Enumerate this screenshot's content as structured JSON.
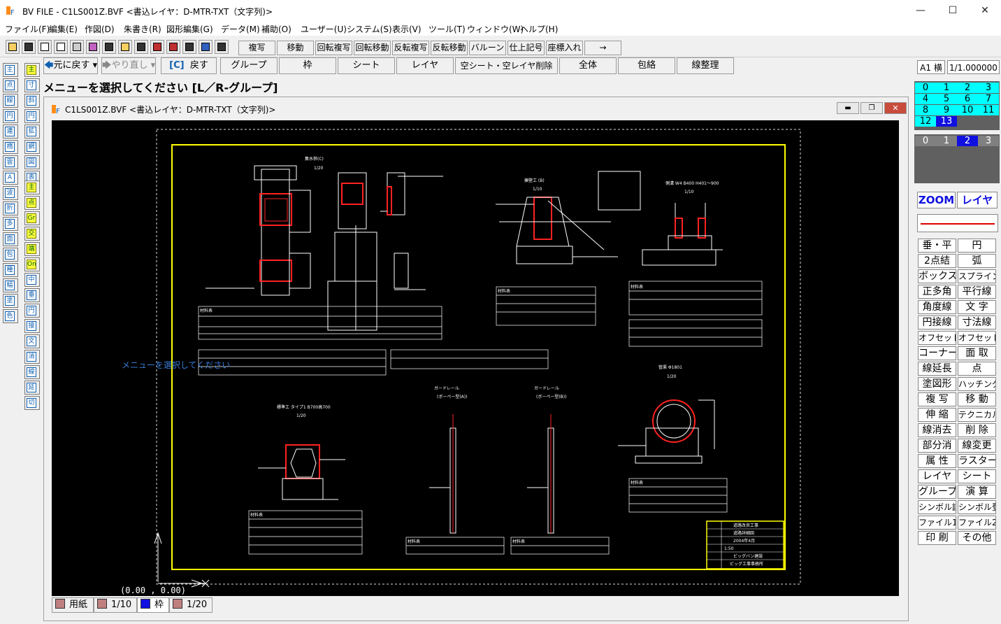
{
  "window": {
    "title": "BV FILE - C1LS001Z.BVF <書込レイヤ：D-MTR-TXT（文字列)>",
    "minimize": "—",
    "maximize": "☐",
    "close": "✕"
  },
  "menu": [
    "ファイル(F)",
    "編集(E)",
    "作図(D)",
    "朱書き(R)",
    "図形編集(G)",
    "データ(M)",
    "補助(O)",
    "ユーザー(U)",
    "システム(S)",
    "表示(V)",
    "ツール(T)",
    "ウィンドウ(W)",
    "ヘルプ(H)"
  ],
  "toolbar1": [
    "複写",
    "移動",
    "回転複写",
    "回転移動",
    "反転複写",
    "反転移動",
    "バルーン",
    "仕上記号",
    "座標入れ",
    "→"
  ],
  "toolbar2": {
    "undo": "元に戻す",
    "redo": "やり直し",
    "back_key": "[C]",
    "back": "戻す",
    "buttons": [
      "グループ",
      "枠",
      "シート",
      "レイヤ",
      "空シート・空レイヤ削除",
      "全体",
      "包絡",
      "線整理"
    ]
  },
  "paper": "A1 横",
  "scale": "1/1.000000",
  "prompt": "メニューを選択してください [L／R-グループ]",
  "doc": {
    "title": "C1LS001Z.BVF <書込レイヤ：D-MTR-TXT（文字列)>",
    "overlay_text": "メニューを選択してください",
    "coord": "(0.00 , 0.00)",
    "drawing_labels": [
      "集水桝(C)",
      "1/20",
      "擁壁工 (B)",
      "1/10",
      "側溝 W4 B400 H401～900",
      "1/10",
      "標準工 タイプ1 B700高700",
      "1/20",
      "ガードレール",
      "(ボーペー型(A))",
      "ガードレール",
      "(ボーペー型(B))",
      "管渠 Φ1801",
      "1/20",
      "材料表",
      "材料表",
      "材料表",
      "材料表",
      "材料表",
      "材料表",
      "材料表"
    ],
    "title_block": [
      "道路改良工事",
      "道路詳細図",
      "2004年4月",
      "1:50",
      "ビッグバン建設",
      "ビッグ工事事務所"
    ],
    "tabs": [
      "用紙",
      "1/10",
      "枠",
      "1/20"
    ]
  },
  "layer_groups": [
    "0",
    "1",
    "2",
    "3",
    "4",
    "5",
    "6",
    "7",
    "8",
    "9",
    "10",
    "11",
    "12",
    "13"
  ],
  "layers": [
    "0",
    "1",
    "2",
    "3"
  ],
  "zoom": "ZOOM",
  "layer_btn": "レイヤ",
  "commands": [
    "垂・平",
    "円",
    "2点結",
    "弧",
    "ボックス",
    "スプライン",
    "正多角",
    "平行線",
    "角度線",
    "文 字",
    "円接線",
    "寸法線",
    "オフセット1",
    "オフセット2",
    "コーナー",
    "面 取",
    "線延長",
    "点",
    "塗図形",
    "ハッチング",
    "複 写",
    "移 動",
    "伸 縮",
    "テクニカル",
    "線消去",
    "削 除",
    "部分消",
    "線変更",
    "属 性",
    "ラスター",
    "レイヤ",
    "シート",
    "グループ",
    "演 算",
    "シンボル読",
    "シンボル登",
    "ファイル1",
    "ファイル2",
    "印 刷",
    "その他"
  ],
  "palette_a": [
    "主",
    "点",
    "線",
    "円",
    "連",
    "楕",
    "雲",
    "A",
    "波",
    "折",
    "多",
    "面",
    "包",
    "種",
    "幅",
    "塗",
    "色"
  ],
  "palette_b": [
    "主",
    "寸",
    "斜",
    "円",
    "拡",
    "網",
    "図",
    "表"
  ],
  "palette_c": [
    "主",
    "点",
    "Gr",
    "交",
    "端",
    "On",
    "中",
    "垂",
    "円",
    "接",
    "文",
    "消",
    "線",
    "延",
    "切"
  ]
}
